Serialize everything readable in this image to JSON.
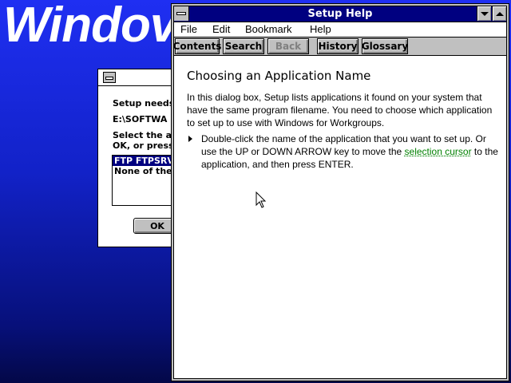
{
  "desktop": {
    "title": "Windov"
  },
  "setup_dialog": {
    "line1": "Setup needs",
    "line2": "E:\\SOFTWA",
    "line3": "Select the ap",
    "line4": "OK, or press",
    "list_items": [
      "FTP FTPSRV",
      "None of the"
    ],
    "ok_label": "OK"
  },
  "help_window": {
    "title": "Setup Help",
    "menu": [
      "File",
      "Edit",
      "Bookmark",
      "Help"
    ],
    "toolbar": [
      "Contents",
      "Search",
      "Back",
      "History",
      "Glossary"
    ],
    "heading": "Choosing an Application Name",
    "paragraph": "In this dialog box, Setup lists applications it found on your system that have the same program filename. You need to choose which application to set up to use with Windows for Workgroups.",
    "bullet_before_link": "Double-click the name of the application that you want to set up. Or use the UP or DOWN ARROW key to move the ",
    "bullet_link": "selection cursor",
    "bullet_after_link": " to the application, and then press ENTER."
  },
  "colors": {
    "titlebar": "#000080",
    "link": "#008000",
    "desktop": "#1f2ff2"
  },
  "icons": [
    "system-menu-icon",
    "minimize-icon",
    "maximize-icon",
    "bullet-arrow-icon",
    "mouse-pointer-icon"
  ]
}
